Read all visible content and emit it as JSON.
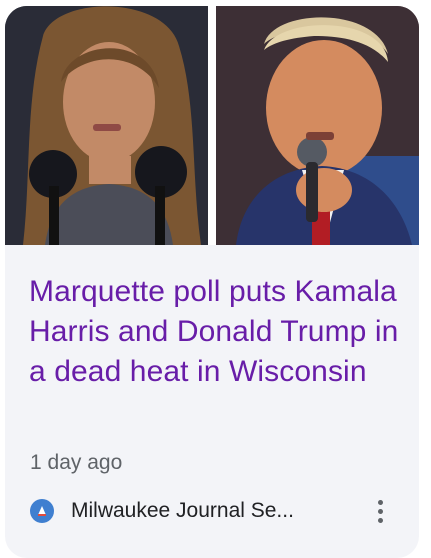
{
  "card": {
    "headline": "Marquette poll puts Kamala Harris and Donald Trump in a dead heat in Wisconsin",
    "time": "1 day ago",
    "source": "Milwaukee Journal Se...",
    "images": [
      {
        "subject": "woman-speaking-at-microphones"
      },
      {
        "subject": "man-speaking-into-microphone"
      }
    ],
    "favicon_icon": "milwaukee-journal-sentinel-favicon",
    "more_icon": "more-vertical-icon"
  },
  "colors": {
    "headline": "#681da8",
    "card_background": "#f3f4f8",
    "meta_text": "#5f6368",
    "source_text": "#202124"
  }
}
